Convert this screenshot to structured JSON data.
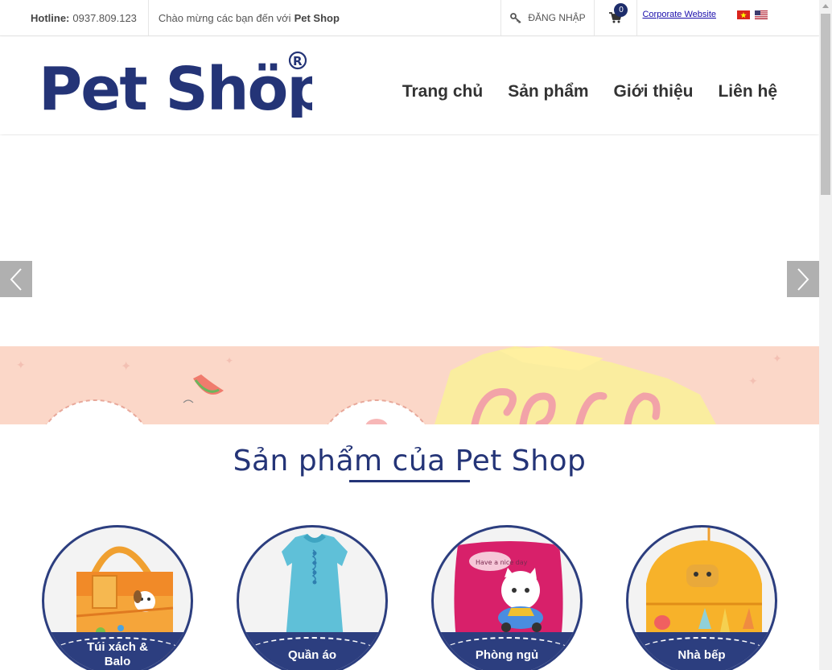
{
  "topbar": {
    "hotline_label": "Hotline:",
    "hotline_number": "0937.809.123",
    "welcome_text": "Chào mừng các bạn đến với",
    "welcome_brand": "Pet Shop",
    "login_label": "ĐĂNG NHẬP",
    "cart_count": "0",
    "corporate_link": "Corporate Website"
  },
  "header": {
    "logo_text": "Pet Shöp",
    "nav": [
      "Trang chủ",
      "Sản phẩm",
      "Giới thiệu",
      "Liên hệ"
    ]
  },
  "products": {
    "title": "Sản phẩm của Pet Shop",
    "categories": [
      {
        "label_line1": "Túi xách &",
        "label_line2": "Balo"
      },
      {
        "label_line1": "Quần áo",
        "label_line2": ""
      },
      {
        "label_line1": "Phòng ngủ",
        "label_line2": ""
      },
      {
        "label_line1": "Nhà bếp",
        "label_line2": ""
      }
    ],
    "pillow_text": "Have a nice day"
  },
  "colors": {
    "brand": "#243477",
    "badge": "#1d2d6b",
    "promo_bg": "#fbd7c8"
  }
}
